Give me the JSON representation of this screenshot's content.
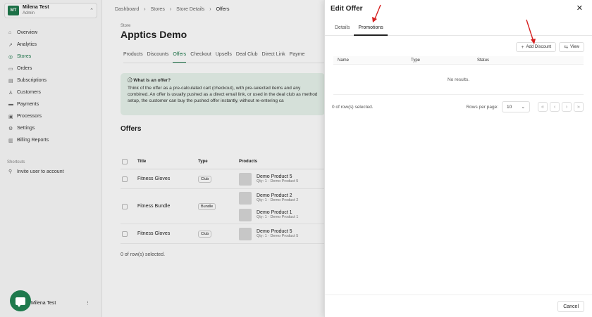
{
  "account": {
    "initials": "MT",
    "name": "Milena Test",
    "role": "Admin"
  },
  "nav": [
    {
      "label": "Overview",
      "icon": "home-icon"
    },
    {
      "label": "Analytics",
      "icon": "chart-icon"
    },
    {
      "label": "Stores",
      "icon": "store-icon",
      "active": true
    },
    {
      "label": "Orders",
      "icon": "cart-icon"
    },
    {
      "label": "Subscriptions",
      "icon": "repeat-icon"
    },
    {
      "label": "Customers",
      "icon": "user-icon"
    },
    {
      "label": "Payments",
      "icon": "card-icon"
    },
    {
      "label": "Processors",
      "icon": "cpu-icon"
    },
    {
      "label": "Settings",
      "icon": "gear-icon"
    },
    {
      "label": "Billing Reports",
      "icon": "report-icon"
    }
  ],
  "shortcuts": {
    "title": "Shortcuts",
    "items": [
      {
        "label": "Invite user to account"
      }
    ]
  },
  "footer_user": "Milena Test",
  "breadcrumbs": [
    "Dashboard",
    "Stores",
    "Store Details",
    "Offers"
  ],
  "store": {
    "label": "Store",
    "name": "Apptics Demo"
  },
  "tabs": [
    "Products",
    "Discounts",
    "Offers",
    "Checkout",
    "Upsells",
    "Deal Club",
    "Direct Link",
    "Payme"
  ],
  "active_tab": "Offers",
  "info": {
    "title": "What is an offer?",
    "text": "Think of the offer as a pre-calculated cart (checkout), with pre-selected items and any combined. An offer is usually pushed as a direct email link, or used in the deal club as method setup, the customer can buy the pushed offer instantly, without re-entering ca"
  },
  "offers": {
    "title": "Offers",
    "columns": [
      "Title",
      "Type",
      "Products"
    ],
    "rows": [
      {
        "title": "Fitness Gloves",
        "type": "Club",
        "products": [
          {
            "name": "Demo Product 5",
            "qty": "Qty: 1 · Demo Product 5"
          }
        ]
      },
      {
        "title": "Fitness Bundle",
        "type": "Bundle",
        "products": [
          {
            "name": "Demo Product 2",
            "qty": "Qty: 1 · Demo Product 2"
          },
          {
            "name": "Demo Product 1",
            "qty": "Qty: 1 · Demo Product 1"
          }
        ]
      },
      {
        "title": "Fitness Gloves",
        "type": "Club",
        "products": [
          {
            "name": "Demo Product 5",
            "qty": "Qty: 1 · Demo Product 5"
          }
        ]
      }
    ],
    "selected": "0 of row(s) selected."
  },
  "sheet": {
    "title": "Edit Offer",
    "tabs": [
      "Details",
      "Promotions"
    ],
    "active_tab": "Promotions",
    "add_discount": "Add Discount",
    "view": "View",
    "columns": {
      "name": "Name",
      "type": "Type",
      "status": "Status"
    },
    "empty": "No results.",
    "selected": "0 of row(s) selected.",
    "rows_per_page_label": "Rows per page:",
    "rows_per_page": "10",
    "cancel": "Cancel"
  },
  "colors": {
    "brand": "#1f7a4d",
    "arrow": "#d62020"
  }
}
